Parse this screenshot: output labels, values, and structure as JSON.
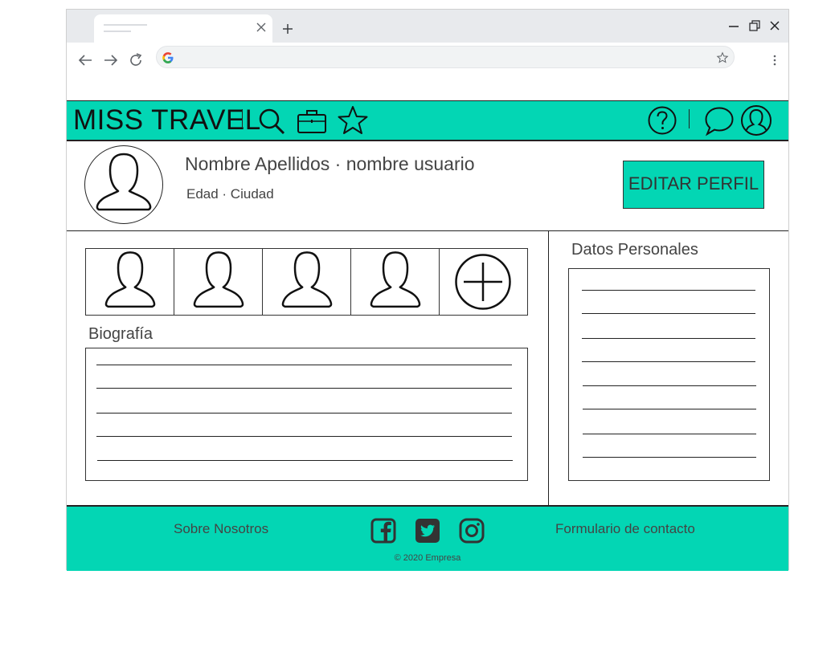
{
  "brand": {
    "title": "MISS TRAVEL"
  },
  "profile": {
    "name_line": "Nombre Apellidos · nombre usuario",
    "meta_line": "Edad · Ciudad",
    "edit_label": "EDITAR PERFIL"
  },
  "sections": {
    "bio_title": "Biografía",
    "personal_title": "Datos Personales"
  },
  "footer": {
    "about_label": "Sobre Nosotros",
    "contact_label": "Formulario de contacto",
    "copyright": "© 2020 Empresa"
  },
  "icons": {
    "topbar": [
      "search-icon",
      "briefcase-icon",
      "star-icon",
      "help-icon",
      "chat-icon",
      "user-icon"
    ],
    "social": [
      "facebook-icon",
      "twitter-icon",
      "instagram-icon"
    ]
  },
  "colors": {
    "accent": "#03d6b4",
    "text": "#444444",
    "ink": "#222222"
  }
}
